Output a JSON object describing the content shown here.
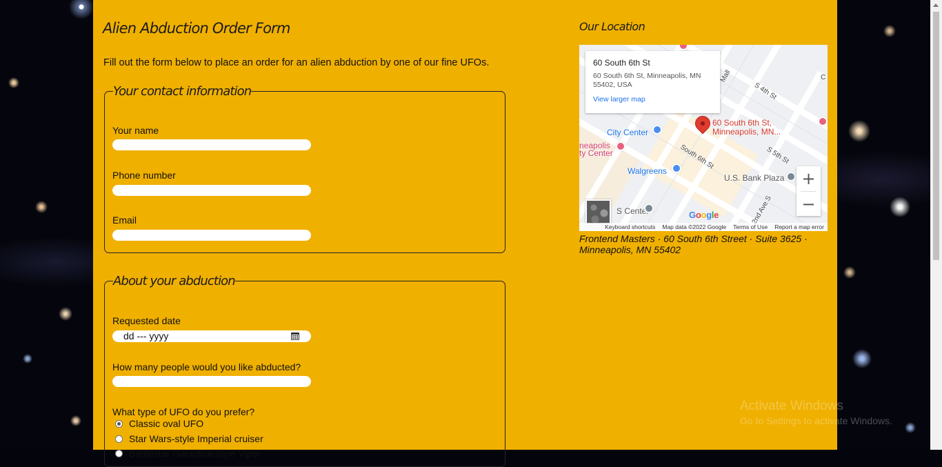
{
  "form": {
    "heading": "Alien Abduction Order Form",
    "intro": "Fill out the form below to place an order for an alien abduction by one of our fine UFOs.",
    "contact": {
      "legend": "Your contact information",
      "name_label": "Your name",
      "phone_label": "Phone number",
      "email_label": "Email"
    },
    "abduction": {
      "legend": "About your abduction",
      "date_label": "Requested date",
      "date_placeholder": "dd --- yyyy",
      "people_label": "How many people would you like abducted?",
      "ufo_label": "What type of UFO do you prefer?",
      "ufo_options": [
        {
          "label": "Classic oval UFO",
          "checked": true
        },
        {
          "label": "Star Wars-style Imperial cruiser",
          "checked": false
        },
        {
          "label": "Battlestar Galactica-style Viper",
          "checked": false
        }
      ]
    }
  },
  "location": {
    "title": "Our Location",
    "map": {
      "card_title": "60 South 6th St",
      "card_address": "60 South 6th St, Minneapolis, MN 55402, USA",
      "larger_map": "View larger map",
      "pin_label_line1": "60 South 6th St,",
      "pin_label_line2": "Minneapolis, MN...",
      "poi": {
        "city_center": "City Center",
        "minneapolis_city_center_1": "neapolis",
        "minneapolis_city_center_2": "ty Center",
        "walgreens": "Walgreens",
        "us_bank_plaza": "U.S. Bank Plaza",
        "s_center": "S Center"
      },
      "streets": {
        "s4th": "S 4th St",
        "s6th": "South 6th St",
        "s5th": "S 5th St",
        "mall": "Mall",
        "ave": "2nd Ave S",
        "c": "C"
      },
      "zoom_in": "+",
      "zoom_out": "−",
      "google": [
        "G",
        "o",
        "o",
        "g",
        "l",
        "e"
      ],
      "attribution": {
        "shortcuts": "Keyboard shortcuts",
        "data": "Map data ©2022 Google",
        "terms": "Terms of Use",
        "report": "Report a map error"
      }
    },
    "address_line": "Frontend Masters · 60 South 6th Street · Suite 3625 · Minneapolis, MN 55402"
  },
  "watermark": {
    "line1": "Activate Windows",
    "line2": "Go to Settings to activate Windows."
  },
  "colors": {
    "page_background": "#f0b000",
    "pin": "#e03b2f",
    "link": "#1a73e8"
  }
}
